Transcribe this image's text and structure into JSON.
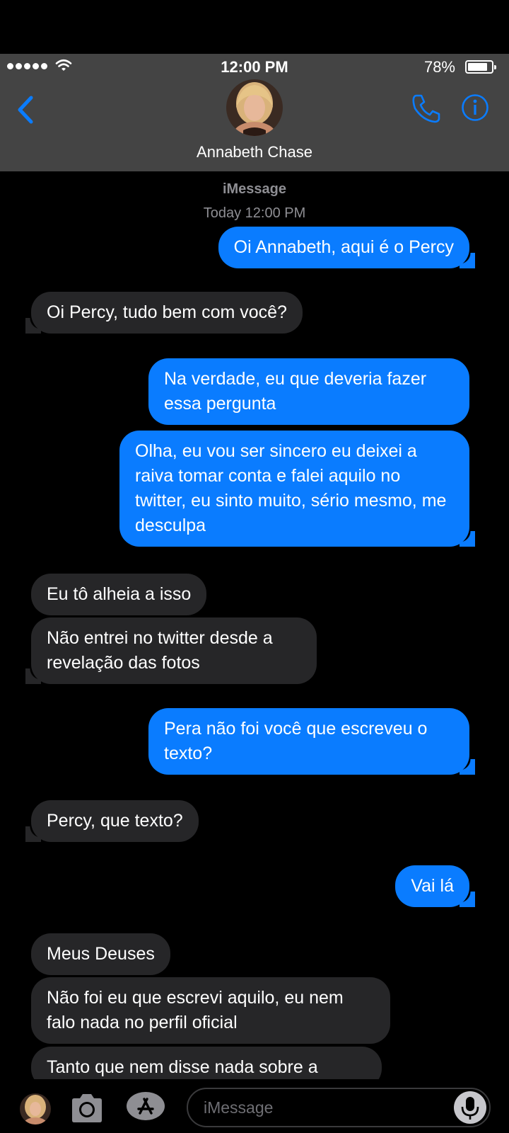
{
  "status_bar": {
    "time": "12:00 PM",
    "battery_text": "78%",
    "battery_level": 0.78
  },
  "header": {
    "contact_name": "Annabeth Chase",
    "back_icon": "chevron-left-icon",
    "call_icon": "phone-icon",
    "info_icon": "info-icon"
  },
  "thread": {
    "service_label": "iMessage",
    "timestamp": "Today 12:00 PM",
    "messages": [
      {
        "direction": "outgoing",
        "text": "Oi Annabeth, aqui é o Percy"
      },
      {
        "direction": "incoming",
        "text": "Oi Percy, tudo bem com você?"
      },
      {
        "direction": "outgoing",
        "text": "Na verdade, eu que deveria fazer essa pergunta"
      },
      {
        "direction": "outgoing",
        "text": "Olha, eu vou ser sincero eu deixei a raiva tomar conta e falei aquilo no twitter, eu sinto muito, sério mesmo, me desculpa"
      },
      {
        "direction": "incoming",
        "text": "Eu tô alheia a isso"
      },
      {
        "direction": "incoming",
        "text": "Não entrei no twitter desde a revelação das fotos"
      },
      {
        "direction": "outgoing",
        "text": "Pera não foi você que escreveu o texto?"
      },
      {
        "direction": "incoming",
        "text": "Percy, que texto?"
      },
      {
        "direction": "outgoing",
        "text": "Vai lá"
      },
      {
        "direction": "incoming",
        "text": "Meus Deuses"
      },
      {
        "direction": "incoming",
        "text": "Não foi eu que escrevi aquilo, eu nem falo nada no perfil oficial"
      },
      {
        "direction": "incoming",
        "text": "Tanto que nem disse nada sobre a"
      }
    ]
  },
  "composer": {
    "placeholder": "iMessage",
    "camera_icon": "camera-icon",
    "apps_icon": "app-store-icon",
    "mic_icon": "microphone-icon"
  },
  "colors": {
    "outgoing_bubble": "#0a7cff",
    "incoming_bubble": "#262628",
    "header_bg": "#444444",
    "accent": "#0a7cff"
  }
}
